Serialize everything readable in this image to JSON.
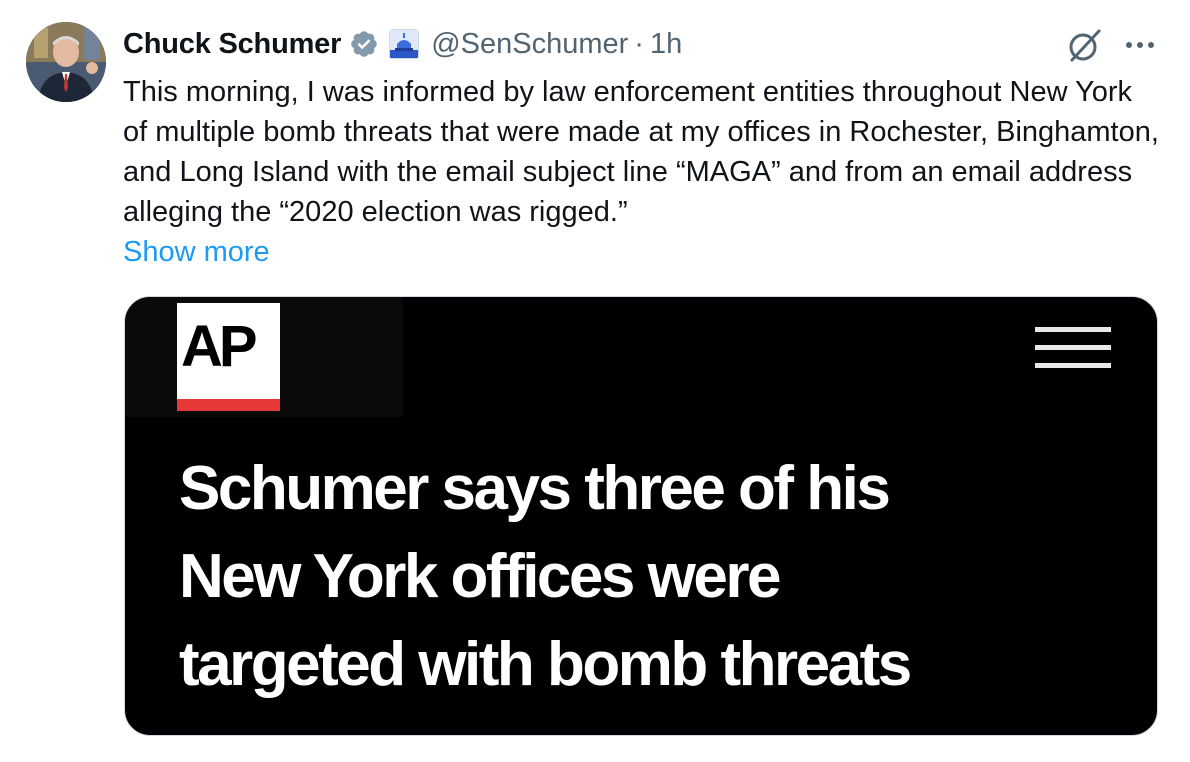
{
  "author": {
    "display_name": "Chuck Schumer",
    "handle": "@SenSchumer",
    "separator": "·",
    "time": "1h",
    "verified_icon": "verified-badge-icon",
    "affiliate_icon": "capitol-building-icon"
  },
  "tweet": {
    "text": "This morning, I was informed by law enforcement entities throughout New York of multiple bomb threats that were made at my offices in Rochester, Binghamton, and Long Island with the email subject line “MAGA” and from an email address alleging the “2020 election was rigged.”",
    "show_more_label": "Show more"
  },
  "media": {
    "logo_text": "AP",
    "headline_lines": [
      "Schumer says three of his",
      "New York offices were",
      "targeted with bomb threats"
    ]
  },
  "colors": {
    "accent_link": "#1d9bf0",
    "verified": "#829aab",
    "ap_red": "#e63838",
    "card_background": "#000000"
  }
}
